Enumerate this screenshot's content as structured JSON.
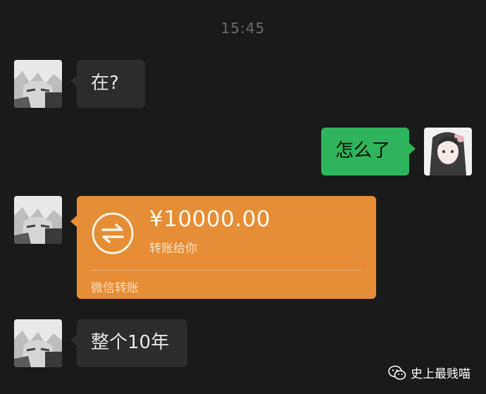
{
  "chat": {
    "timestamp": "15:45",
    "messages": [
      {
        "sender": "other",
        "text": "在?"
      },
      {
        "sender": "self",
        "text": "怎么了"
      },
      {
        "sender": "other",
        "type": "transfer",
        "amount": "¥10000.00",
        "subtitle": "转账给你",
        "footer": "微信转账"
      },
      {
        "sender": "other",
        "text": "整个10年"
      }
    ]
  },
  "watermark": {
    "text": "史上最贱喵",
    "icon": "wechat-icon"
  },
  "colors": {
    "background": "#1a1a1a",
    "incoming_bubble": "#2c2c2c",
    "outgoing_bubble": "#2eb55b",
    "transfer_card": "#e58e35"
  }
}
